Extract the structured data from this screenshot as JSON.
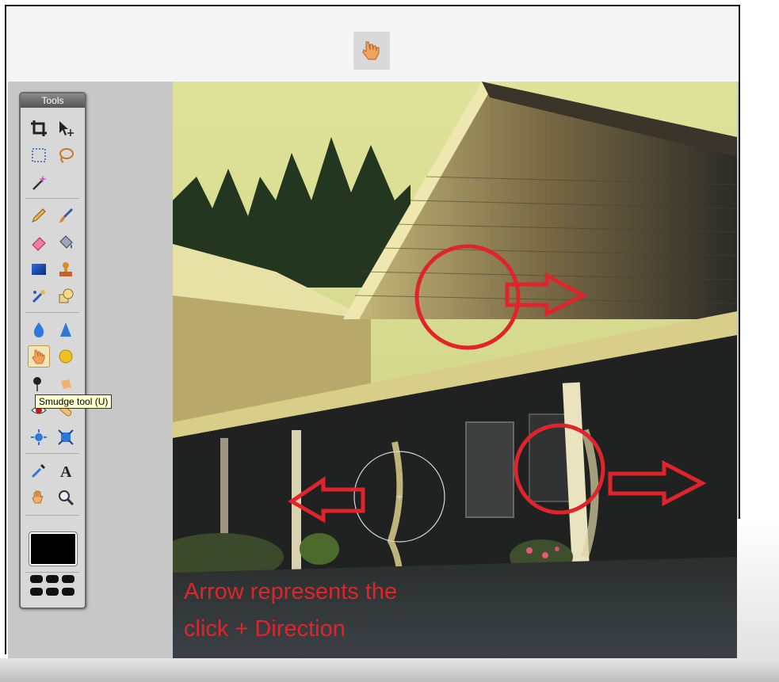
{
  "window": {
    "top_tool_icon": "smudge-hand-icon"
  },
  "tools_panel": {
    "title": "Tools",
    "tooltip": "Smudge tool (U)",
    "icons": [
      "crop-icon",
      "move-icon",
      "marquee-icon",
      "lasso-icon",
      "magic-wand-icon",
      "pencil-icon",
      "brush-icon",
      "eraser-icon",
      "paint-bucket-icon",
      "gradient-icon",
      "stamp-icon",
      "color-replace-icon",
      "shape-icon",
      "blur-icon",
      "sharpen-icon",
      "smudge-icon",
      "sponge-icon",
      "dodge-icon",
      "burn-icon",
      "red-eye-icon",
      "spot-heal-icon",
      "bloat-icon",
      "pinch-icon",
      "eyedropper-icon",
      "type-icon",
      "hand-icon",
      "zoom-icon"
    ],
    "foreground_color": "#000000",
    "active_tool": "smudge-icon"
  },
  "canvas": {
    "caption_line1": "Arrow represents the",
    "caption_line2": "click + Direction",
    "annotation_color": "#e0242c"
  }
}
